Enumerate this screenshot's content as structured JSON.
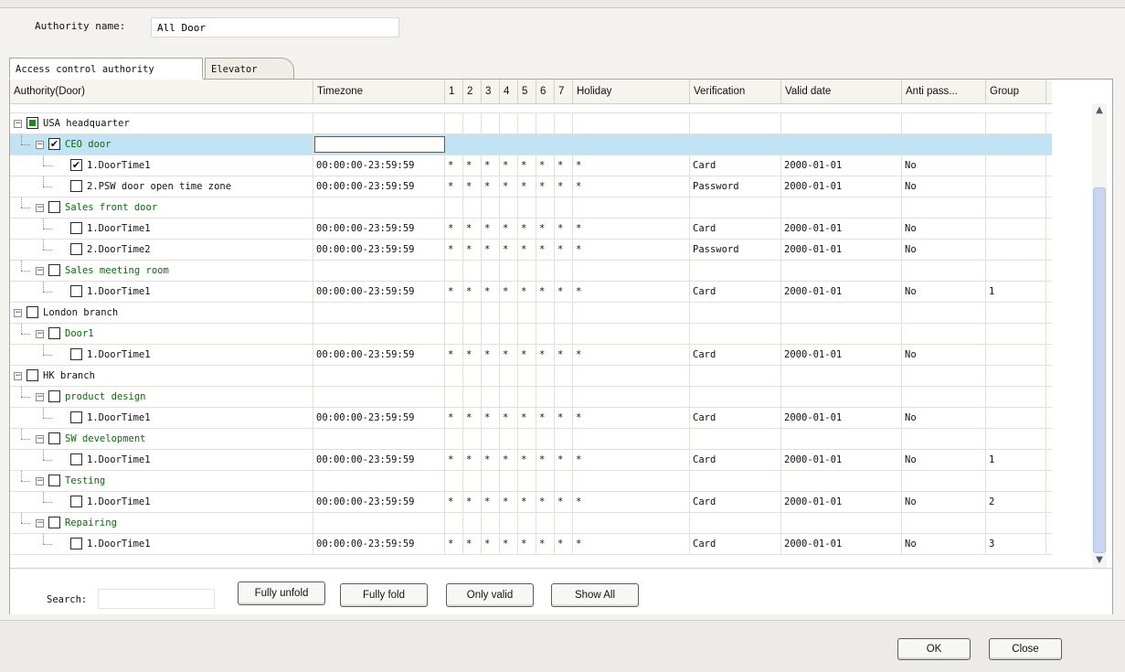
{
  "authority": {
    "label": "Authority name:",
    "value": "All Door"
  },
  "tabs": [
    {
      "label": "Access control authority"
    },
    {
      "label": "Elevator"
    }
  ],
  "columns": {
    "name": "Authority(Door)",
    "timezone": "Timezone",
    "d1": "1",
    "d2": "2",
    "d3": "3",
    "d4": "4",
    "d5": "5",
    "d6": "6",
    "d7": "7",
    "holiday": "Holiday",
    "verification": "Verification",
    "valid_date": "Valid date",
    "anti": "Anti pass...",
    "group": "Group"
  },
  "rows": [
    {
      "level": 0,
      "type": "group",
      "label": "USA headquarter",
      "check": "partial",
      "expander": "−"
    },
    {
      "level": 1,
      "type": "door",
      "label": "CEO door",
      "check": "checked",
      "expander": "−",
      "selected": true
    },
    {
      "level": 2,
      "type": "time",
      "label": "1.DoorTime1",
      "check": "checked",
      "timezone": "00:00:00-23:59:59",
      "days": [
        "*",
        "*",
        "*",
        "*",
        "*",
        "*",
        "*",
        "*"
      ],
      "verification": "Card",
      "valid_date": "2000-01-01",
      "anti": "No",
      "group": ""
    },
    {
      "level": 2,
      "type": "time",
      "label": "2.PSW door open time zone",
      "check": "none",
      "timezone": "00:00:00-23:59:59",
      "days": [
        "*",
        "*",
        "*",
        "*",
        "*",
        "*",
        "*",
        "*"
      ],
      "verification": "Password",
      "valid_date": "2000-01-01",
      "anti": "No",
      "group": ""
    },
    {
      "level": 1,
      "type": "door",
      "label": "Sales front door",
      "check": "none",
      "expander": "−"
    },
    {
      "level": 2,
      "type": "time",
      "label": "1.DoorTime1",
      "check": "none",
      "timezone": "00:00:00-23:59:59",
      "days": [
        "*",
        "*",
        "*",
        "*",
        "*",
        "*",
        "*",
        "*"
      ],
      "verification": "Card",
      "valid_date": "2000-01-01",
      "anti": "No",
      "group": ""
    },
    {
      "level": 2,
      "type": "time",
      "label": "2.DoorTime2",
      "check": "none",
      "timezone": "00:00:00-23:59:59",
      "days": [
        "*",
        "*",
        "*",
        "*",
        "*",
        "*",
        "*",
        "*"
      ],
      "verification": "Password",
      "valid_date": "2000-01-01",
      "anti": "No",
      "group": ""
    },
    {
      "level": 1,
      "type": "door",
      "label": "Sales meeting room",
      "check": "none",
      "expander": "−"
    },
    {
      "level": 2,
      "type": "time",
      "label": "1.DoorTime1",
      "check": "none",
      "timezone": "00:00:00-23:59:59",
      "days": [
        "*",
        "*",
        "*",
        "*",
        "*",
        "*",
        "*",
        "*"
      ],
      "verification": "Card",
      "valid_date": "2000-01-01",
      "anti": "No",
      "group": "1"
    },
    {
      "level": 0,
      "type": "group",
      "label": "London branch",
      "check": "none",
      "expander": "−"
    },
    {
      "level": 1,
      "type": "door",
      "label": "Door1",
      "check": "none",
      "expander": "−"
    },
    {
      "level": 2,
      "type": "time",
      "label": "1.DoorTime1",
      "check": "none",
      "timezone": "00:00:00-23:59:59",
      "days": [
        "*",
        "*",
        "*",
        "*",
        "*",
        "*",
        "*",
        "*"
      ],
      "verification": "Card",
      "valid_date": "2000-01-01",
      "anti": "No",
      "group": ""
    },
    {
      "level": 0,
      "type": "group",
      "label": "HK branch",
      "check": "none",
      "expander": "−"
    },
    {
      "level": 1,
      "type": "door",
      "label": "product design",
      "check": "none",
      "expander": "−"
    },
    {
      "level": 2,
      "type": "time",
      "label": "1.DoorTime1",
      "check": "none",
      "timezone": "00:00:00-23:59:59",
      "days": [
        "*",
        "*",
        "*",
        "*",
        "*",
        "*",
        "*",
        "*"
      ],
      "verification": "Card",
      "valid_date": "2000-01-01",
      "anti": "No",
      "group": ""
    },
    {
      "level": 1,
      "type": "door",
      "label": "SW development",
      "check": "none",
      "expander": "−"
    },
    {
      "level": 2,
      "type": "time",
      "label": "1.DoorTime1",
      "check": "none",
      "timezone": "00:00:00-23:59:59",
      "days": [
        "*",
        "*",
        "*",
        "*",
        "*",
        "*",
        "*",
        "*"
      ],
      "verification": "Card",
      "valid_date": "2000-01-01",
      "anti": "No",
      "group": "1"
    },
    {
      "level": 1,
      "type": "door",
      "label": "Testing",
      "check": "none",
      "expander": "−"
    },
    {
      "level": 2,
      "type": "time",
      "label": "1.DoorTime1",
      "check": "none",
      "timezone": "00:00:00-23:59:59",
      "days": [
        "*",
        "*",
        "*",
        "*",
        "*",
        "*",
        "*",
        "*"
      ],
      "verification": "Card",
      "valid_date": "2000-01-01",
      "anti": "No",
      "group": "2"
    },
    {
      "level": 1,
      "type": "door",
      "label": "Repairing",
      "check": "none",
      "expander": "−"
    },
    {
      "level": 2,
      "type": "time",
      "label": "1.DoorTime1",
      "check": "none",
      "timezone": "00:00:00-23:59:59",
      "days": [
        "*",
        "*",
        "*",
        "*",
        "*",
        "*",
        "*",
        "*"
      ],
      "verification": "Card",
      "valid_date": "2000-01-01",
      "anti": "No",
      "group": "3"
    }
  ],
  "scrollbar": {
    "up": "▲",
    "down": "▼"
  },
  "search": {
    "label": "Search:",
    "value": ""
  },
  "buttons": {
    "fully_unfold": "Fully unfold",
    "fully_fold": "Fully fold",
    "only_valid": "Only valid",
    "show_all": "Show All",
    "ok": "OK",
    "close": "Close"
  },
  "colors": {
    "selected_row": "#c2e3f4",
    "child_text": "#0a6b0a",
    "partial_check": "#1a8c1a"
  }
}
